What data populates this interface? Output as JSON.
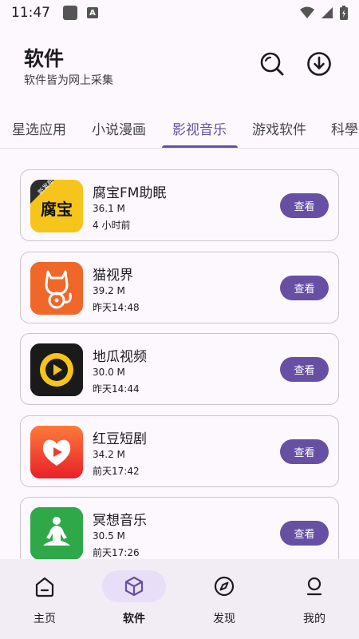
{
  "status": {
    "time": "11:47"
  },
  "header": {
    "title": "软件",
    "subtitle": "软件皆为网上采集"
  },
  "tabs": [
    {
      "label": "星选应用"
    },
    {
      "label": "小说漫画"
    },
    {
      "label": "影视音乐"
    },
    {
      "label": "游戏软件"
    },
    {
      "label": "科學"
    }
  ],
  "active_tab": "影视音乐",
  "apps": [
    {
      "name": "腐宝FM助眠",
      "size": "36.1 M",
      "time": "4 小时前",
      "button": "查看",
      "icon_text": "腐宝",
      "badge": "新发布",
      "icon": "fubao-fm-icon"
    },
    {
      "name": "猫视界",
      "size": "39.2 M",
      "time": "昨天14:48",
      "button": "查看",
      "icon": "cat-video-icon"
    },
    {
      "name": "地瓜视频",
      "size": "30.0 M",
      "time": "昨天14:44",
      "button": "查看",
      "icon": "play-circle-icon"
    },
    {
      "name": "红豆短剧",
      "size": "34.2 M",
      "time": "前天17:42",
      "button": "查看",
      "icon": "heart-play-icon"
    },
    {
      "name": "冥想音乐",
      "size": "30.5 M",
      "time": "前天17:26",
      "button": "查看",
      "icon": "meditation-icon"
    }
  ],
  "nav": [
    {
      "label": "主页",
      "icon": "home-icon"
    },
    {
      "label": "软件",
      "icon": "cube-icon",
      "active": true
    },
    {
      "label": "发现",
      "icon": "compass-icon"
    },
    {
      "label": "我的",
      "icon": "person-icon"
    }
  ],
  "colors": {
    "accent": "#6750a4",
    "nav_bg": "#f2ecf4",
    "active_pill": "#e8def8"
  }
}
